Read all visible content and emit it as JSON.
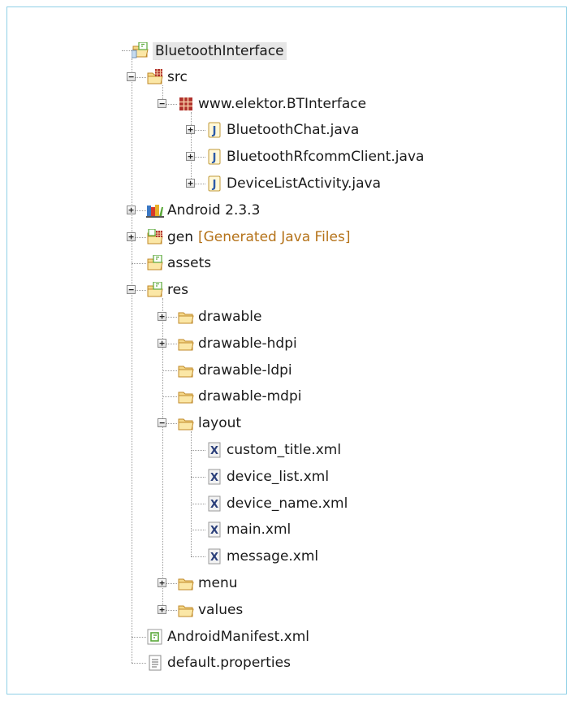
{
  "tree": [
    {
      "label": "BluetoothInterface",
      "icon": "android-project-icon",
      "depth": 0,
      "expander": "none",
      "selected": true
    },
    {
      "label": "src",
      "icon": "source-folder-icon",
      "depth": 1,
      "expander": "minus"
    },
    {
      "label": "www.elektor.BTInterface",
      "icon": "package-icon",
      "depth": 2,
      "expander": "minus"
    },
    {
      "label": "BluetoothChat.java",
      "icon": "java-file-icon",
      "depth": 3,
      "expander": "plus"
    },
    {
      "label": "BluetoothRfcommClient.java",
      "icon": "java-file-icon",
      "depth": 3,
      "expander": "plus"
    },
    {
      "label": "DeviceListActivity.java",
      "icon": "java-file-icon",
      "depth": 3,
      "expander": "plus"
    },
    {
      "label": "Android 2.3.3",
      "icon": "library-icon",
      "depth": 1,
      "expander": "plus"
    },
    {
      "label": "gen",
      "decoration": "[Generated Java Files]",
      "icon": "generated-folder-icon",
      "depth": 1,
      "expander": "plus"
    },
    {
      "label": "assets",
      "icon": "android-folder-icon",
      "depth": 1,
      "expander": "none"
    },
    {
      "label": "res",
      "icon": "android-folder-icon",
      "depth": 1,
      "expander": "minus"
    },
    {
      "label": "drawable",
      "icon": "folder-icon",
      "depth": 2,
      "expander": "plus"
    },
    {
      "label": "drawable-hdpi",
      "icon": "folder-icon",
      "depth": 2,
      "expander": "plus"
    },
    {
      "label": "drawable-ldpi",
      "icon": "folder-icon",
      "depth": 2,
      "expander": "none"
    },
    {
      "label": "drawable-mdpi",
      "icon": "folder-icon",
      "depth": 2,
      "expander": "none"
    },
    {
      "label": "layout",
      "icon": "folder-icon",
      "depth": 2,
      "expander": "minus"
    },
    {
      "label": "custom_title.xml",
      "icon": "xml-file-icon",
      "depth": 3,
      "expander": "none"
    },
    {
      "label": "device_list.xml",
      "icon": "xml-file-icon",
      "depth": 3,
      "expander": "none"
    },
    {
      "label": "device_name.xml",
      "icon": "xml-file-icon",
      "depth": 3,
      "expander": "none"
    },
    {
      "label": "main.xml",
      "icon": "xml-file-icon",
      "depth": 3,
      "expander": "none"
    },
    {
      "label": "message.xml",
      "icon": "xml-file-icon",
      "depth": 3,
      "expander": "none"
    },
    {
      "label": "menu",
      "icon": "folder-icon",
      "depth": 2,
      "expander": "plus"
    },
    {
      "label": "values",
      "icon": "folder-icon",
      "depth": 2,
      "expander": "plus"
    },
    {
      "label": "AndroidManifest.xml",
      "icon": "android-manifest-icon",
      "depth": 1,
      "expander": "none"
    },
    {
      "label": "default.properties",
      "icon": "text-file-icon",
      "depth": 1,
      "expander": "none"
    }
  ],
  "colors": {
    "frame_border": "#8fd0e6",
    "folder_fill": "#f5d889",
    "folder_stroke": "#c08a2a",
    "java_blue": "#2b5aa8",
    "package_red": "#b0302c",
    "decoration": "#b5731a",
    "android_green": "#5aa83a"
  }
}
